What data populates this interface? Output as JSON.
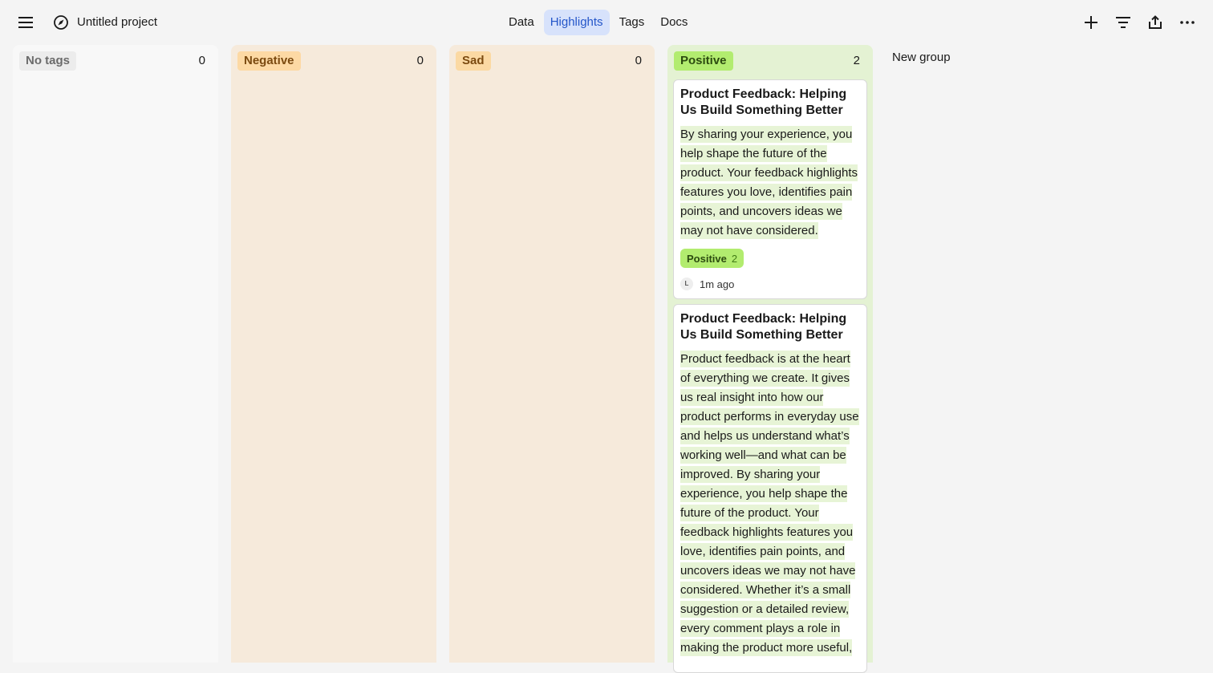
{
  "header": {
    "project_name": "Untitled project",
    "tabs": [
      {
        "label": "Data"
      },
      {
        "label": "Highlights"
      },
      {
        "label": "Tags"
      },
      {
        "label": "Docs"
      }
    ],
    "active_tab": "Highlights"
  },
  "columns": [
    {
      "label": "No tags",
      "count": "0"
    },
    {
      "label": "Negative",
      "count": "0"
    },
    {
      "label": "Sad",
      "count": "0"
    },
    {
      "label": "Positive",
      "count": "2"
    }
  ],
  "cards": [
    {
      "title": "Product Feedback: Helping Us Build Something Better",
      "text": "By sharing your experience, you help shape the future of the product. Your feedback highlights features you love, identifies pain points, and uncovers ideas we may not have considered.",
      "tag": "Positive",
      "tag_count": "2",
      "avatar": "L",
      "time": "1m ago"
    },
    {
      "title": "Product Feedback: Helping Us Build Something Better",
      "text": "Product feedback is at the heart of everything we create. It gives us real insight into how our product performs in everyday use and helps us understand what’s working well—and what can be improved. By sharing your experience, you help shape the future of the product. Your feedback highlights features you love, identifies pain points, and uncovers ideas we may not have considered. Whether it’s a small suggestion or a detailed review, every comment plays a role in making the product more useful,"
    }
  ],
  "new_group_label": "New group",
  "colors": {
    "active_tab_bg": "#d7e2fb",
    "active_tab_text": "#2456c9",
    "positive": "#b2ec6f",
    "negative": "#fdd9a4",
    "highlight": "#e7f4d6"
  },
  "icons": {
    "menu": "menu-icon",
    "project": "compass-icon",
    "add": "plus-icon",
    "filter": "filter-icon",
    "share": "share-icon",
    "more": "more-icon"
  }
}
